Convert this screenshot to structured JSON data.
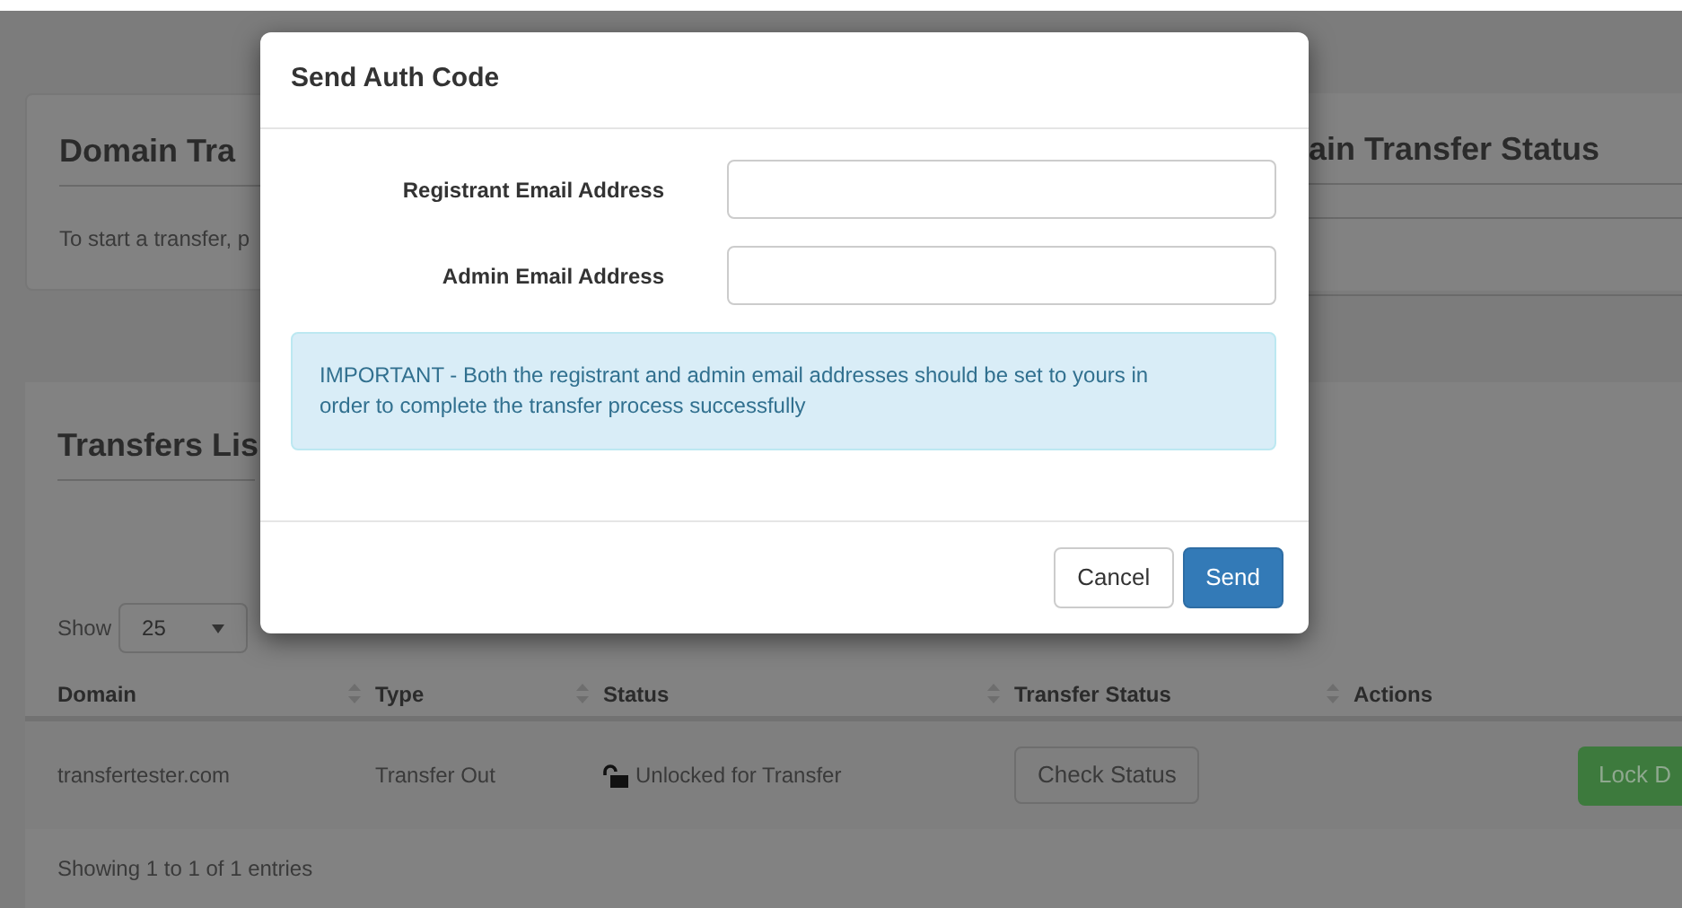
{
  "page": {
    "transfer_panel": {
      "title": "Domain Tra",
      "text": "To start a transfer, p"
    },
    "status_panel": {
      "title": "ain Transfer Status"
    },
    "transfers_list": {
      "title": "Transfers Lis",
      "show_label": "Show",
      "page_size": "25",
      "columns": [
        "Domain",
        "Type",
        "Status",
        "Transfer Status",
        "Actions"
      ],
      "rows": [
        {
          "domain": "transfertester.com",
          "type": "Transfer Out",
          "status": "Unlocked for Transfer",
          "locked": false,
          "check_button": "Check Status",
          "action_button": "Lock D"
        }
      ],
      "footer": "Showing 1 to 1 of 1 entries"
    }
  },
  "modal": {
    "title": "Send Auth Code",
    "fields": [
      {
        "label": "Registrant Email Address"
      },
      {
        "label": "Admin Email Address"
      }
    ],
    "alert": "IMPORTANT - Both the registrant and admin email addresses should be set to yours in order to complete the transfer process successfully",
    "buttons": [
      {
        "label": "Cancel",
        "kind": "default"
      },
      {
        "label": "Send",
        "kind": "primary"
      }
    ]
  }
}
